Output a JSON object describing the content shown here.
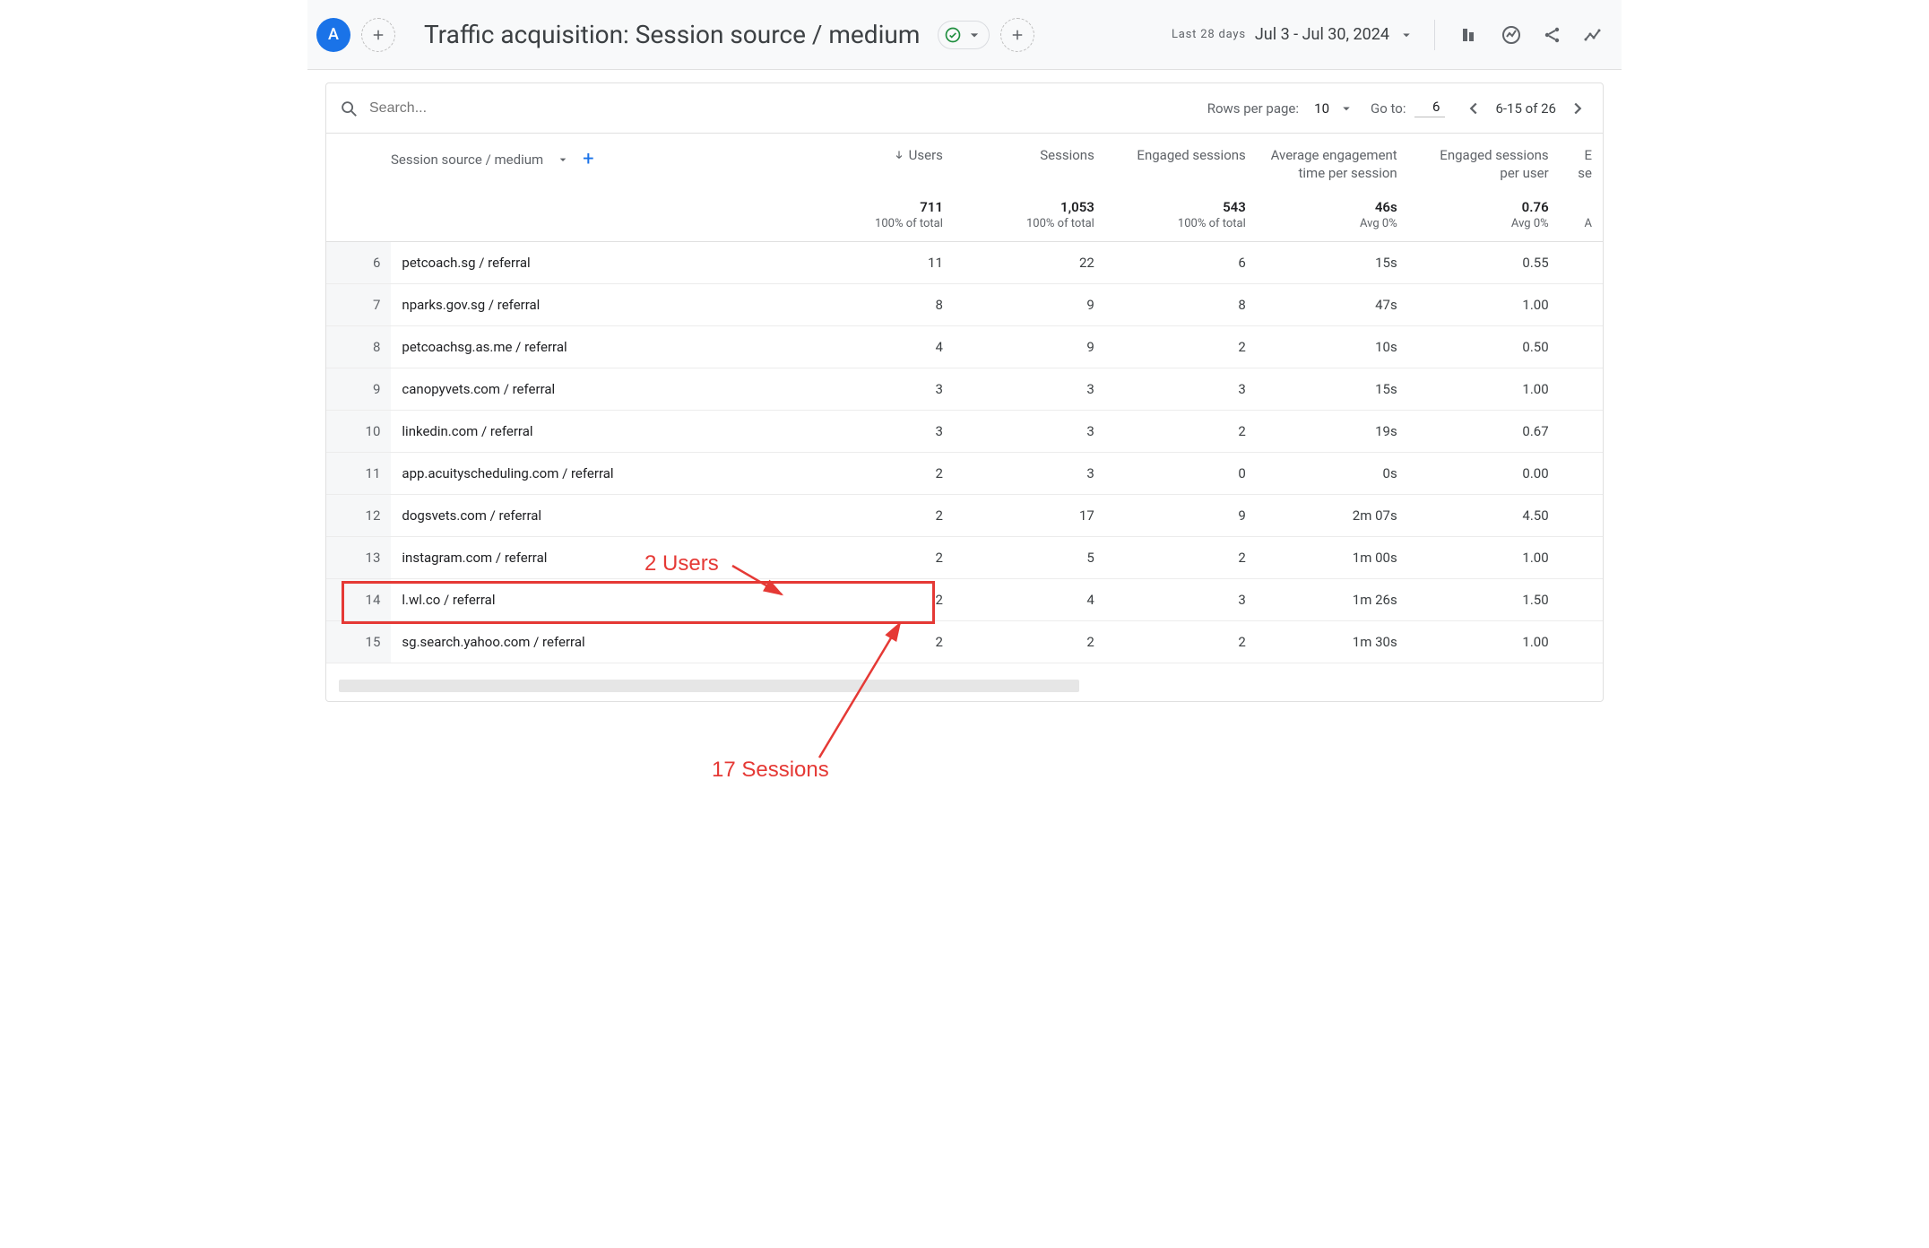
{
  "avatar_initial": "A",
  "report_title": "Traffic acquisition: Session source / medium",
  "date": {
    "label": "Last 28 days",
    "range": "Jul 3 - Jul 30, 2024"
  },
  "search": {
    "placeholder": "Search..."
  },
  "pagination": {
    "rows_per_page_label": "Rows per page:",
    "rows_per_page_value": "10",
    "go_to_label": "Go to:",
    "go_to_value": "6",
    "range": "6-15 of 26"
  },
  "dimension": {
    "label": "Session source / medium"
  },
  "columns": {
    "users": "Users",
    "sessions": "Sessions",
    "engaged": "Engaged sessions",
    "avg_engagement": "Average engagement time per session",
    "eng_per_user": "Engaged sessions per user",
    "cut": "E\nse"
  },
  "totals": {
    "users": "711",
    "sessions": "1,053",
    "engaged": "543",
    "avg_engagement": "46s",
    "eng_per_user": "0.76"
  },
  "totals_sub": {
    "users": "100% of total",
    "sessions": "100% of total",
    "engaged": "100% of total",
    "avg_engagement": "Avg 0%",
    "eng_per_user": "Avg 0%",
    "cut": "A"
  },
  "rows": [
    {
      "idx": "6",
      "name": "petcoach.sg / referral",
      "users": "11",
      "sessions": "22",
      "engaged": "6",
      "avg": "15s",
      "epu": "0.55"
    },
    {
      "idx": "7",
      "name": "nparks.gov.sg / referral",
      "users": "8",
      "sessions": "9",
      "engaged": "8",
      "avg": "47s",
      "epu": "1.00"
    },
    {
      "idx": "8",
      "name": "petcoachsg.as.me / referral",
      "users": "4",
      "sessions": "9",
      "engaged": "2",
      "avg": "10s",
      "epu": "0.50"
    },
    {
      "idx": "9",
      "name": "canopyvets.com / referral",
      "users": "3",
      "sessions": "3",
      "engaged": "3",
      "avg": "15s",
      "epu": "1.00"
    },
    {
      "idx": "10",
      "name": "linkedin.com / referral",
      "users": "3",
      "sessions": "3",
      "engaged": "2",
      "avg": "19s",
      "epu": "0.67"
    },
    {
      "idx": "11",
      "name": "app.acuityscheduling.com / referral",
      "users": "2",
      "sessions": "3",
      "engaged": "0",
      "avg": "0s",
      "epu": "0.00"
    },
    {
      "idx": "12",
      "name": "dogsvets.com / referral",
      "users": "2",
      "sessions": "17",
      "engaged": "9",
      "avg": "2m 07s",
      "epu": "4.50"
    },
    {
      "idx": "13",
      "name": "instagram.com / referral",
      "users": "2",
      "sessions": "5",
      "engaged": "2",
      "avg": "1m 00s",
      "epu": "1.00"
    },
    {
      "idx": "14",
      "name": "l.wl.co / referral",
      "users": "2",
      "sessions": "4",
      "engaged": "3",
      "avg": "1m 26s",
      "epu": "1.50"
    },
    {
      "idx": "15",
      "name": "sg.search.yahoo.com / referral",
      "users": "2",
      "sessions": "2",
      "engaged": "2",
      "avg": "1m 30s",
      "epu": "1.00"
    }
  ],
  "annotations": {
    "users": "2 Users",
    "sessions": "17 Sessions"
  }
}
